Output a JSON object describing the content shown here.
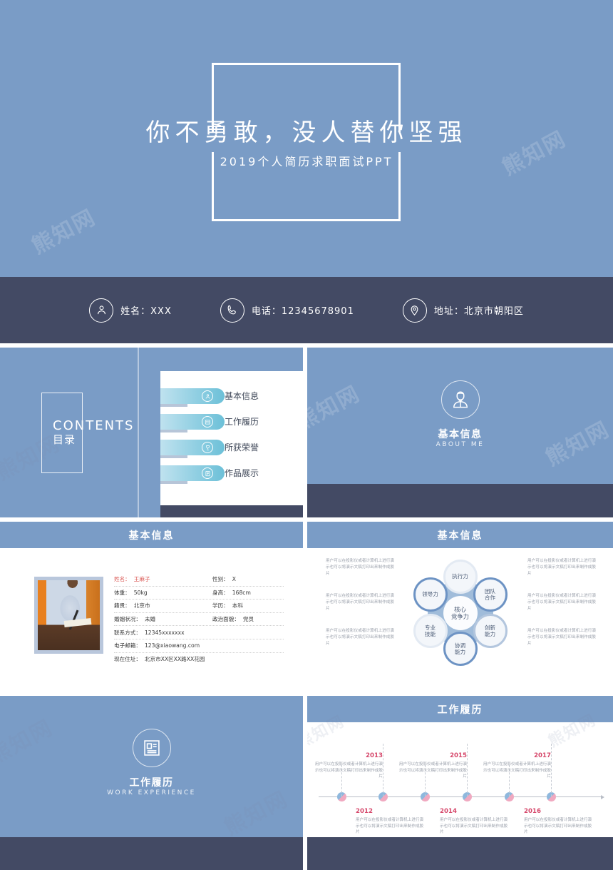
{
  "theme": {
    "primary_blue": "#7a9cc6",
    "dark_navy": "#434a64",
    "accent_teal": "#6cc0d8",
    "accent_pink": "#d6486b",
    "highlight_red": "#d9534f",
    "body_gray": "#9aa0ab",
    "white": "#ffffff"
  },
  "watermark": {
    "text": "熊知网"
  },
  "placeholder_text": "用户可以在投影仪或者计算机上进行演示也可以将演示文稿打印出来制作成胶片",
  "title_slide": {
    "main_title": "你不勇敢，没人替你坚强",
    "subtitle": "2019个人简历求职面试PPT"
  },
  "contact_bar": {
    "items": [
      {
        "icon": "person-icon",
        "label": "姓名：XXX"
      },
      {
        "icon": "phone-icon",
        "label": "电话：12345678901"
      },
      {
        "icon": "location-icon",
        "label": "地址：北京市朝阳区"
      }
    ]
  },
  "contents_slide": {
    "title_en": "CONTENTS",
    "title_cn": "目录",
    "items": [
      {
        "icon": "person-icon",
        "label": "基本信息"
      },
      {
        "icon": "idcard-icon",
        "label": "工作履历"
      },
      {
        "icon": "trophy-icon",
        "label": "所获荣誉"
      },
      {
        "icon": "document-icon",
        "label": "作品展示"
      }
    ]
  },
  "about_divider": {
    "icon": "person-badge-icon",
    "title_cn": "基本信息",
    "title_en": "ABOUT ME"
  },
  "basic_info_slide": {
    "header": "基本信息",
    "photo_alt": "候选人照片",
    "rows": [
      {
        "highlight": true,
        "left": {
          "key": "姓名：",
          "value": "王麻子"
        },
        "right": {
          "key": "性别：",
          "value": "X"
        }
      },
      {
        "highlight": false,
        "left": {
          "key": "体重：",
          "value": "50kg"
        },
        "right": {
          "key": "身高：",
          "value": "168cm"
        }
      },
      {
        "highlight": false,
        "left": {
          "key": "籍贯：",
          "value": "北京市"
        },
        "right": {
          "key": "学历：",
          "value": "本科"
        }
      },
      {
        "highlight": false,
        "left": {
          "key": "婚姻状况：",
          "value": "未婚"
        },
        "right": {
          "key": "政治面貌：",
          "value": "党员"
        }
      },
      {
        "highlight": false,
        "left": {
          "key": "联系方式：",
          "value": "12345xxxxxxx"
        },
        "right": {
          "key": "",
          "value": ""
        }
      },
      {
        "highlight": false,
        "left": {
          "key": "电子邮箱：",
          "value": "123@xiaowang.com"
        },
        "right": {
          "key": "",
          "value": ""
        }
      },
      {
        "highlight": false,
        "left": {
          "key": "现在住址：",
          "value": "北京市XX区XX路XX花园"
        },
        "right": {
          "key": "",
          "value": ""
        }
      }
    ]
  },
  "core_competency_slide": {
    "header": "基本信息",
    "center_label": "核心\n竞争力",
    "petals": [
      {
        "label": "执行力",
        "position": "top",
        "style": "lite"
      },
      {
        "label": "团队\n合作",
        "position": "top-right",
        "style": "dark"
      },
      {
        "label": "创新\n能力",
        "position": "bottom-right",
        "style": "mid"
      },
      {
        "label": "协调\n能力",
        "position": "bottom",
        "style": "dark"
      },
      {
        "label": "专业\n技能",
        "position": "bottom-left",
        "style": "lite"
      },
      {
        "label": "领导力",
        "position": "top-left",
        "style": "dark"
      }
    ],
    "left_paragraphs": [
      "用户可以在投影仪或者计算机上进行演示也可以将演示文稿打印出来制作成胶片",
      "用户可以在投影仪或者计算机上进行演示也可以将演示文稿打印出来制作成胶片",
      "用户可以在投影仪或者计算机上进行演示也可以将演示文稿打印出来制作成胶片"
    ],
    "right_paragraphs": [
      "用户可以在投影仪或者计算机上进行演示也可以将演示文稿打印出来制作成胶片",
      "用户可以在投影仪或者计算机上进行演示也可以将演示文稿打印出来制作成胶片",
      "用户可以在投影仪或者计算机上进行演示也可以将演示文稿打印出来制作成胶片"
    ]
  },
  "work_divider": {
    "icon": "idcard-icon",
    "title_cn": "工作履历",
    "title_en": "WORK EXPERIENCE"
  },
  "timeline_slide": {
    "header": "工作履历",
    "events": [
      {
        "year": "2013",
        "placement": "above",
        "text": "用户可以在投影仪或者计算机上进行演示也可以将演示文稿打印出来制作成胶片"
      },
      {
        "year": "2015",
        "placement": "above",
        "text": "用户可以在投影仪或者计算机上进行演示也可以将演示文稿打印出来制作成胶片"
      },
      {
        "year": "2017",
        "placement": "above",
        "text": "用户可以在投影仪或者计算机上进行演示也可以将演示文稿打印出来制作成胶片"
      },
      {
        "year": "2012",
        "placement": "below",
        "text": "用户可以在投影仪或者计算机上进行演示也可以将演示文稿打印出来制作成胶片"
      },
      {
        "year": "2014",
        "placement": "below",
        "text": "用户可以在投影仪或者计算机上进行演示也可以将演示文稿打印出来制作成胶片"
      },
      {
        "year": "2016",
        "placement": "below",
        "text": "用户可以在投影仪或者计算机上进行演示也可以将演示文稿打印出来制作成胶片"
      }
    ]
  }
}
